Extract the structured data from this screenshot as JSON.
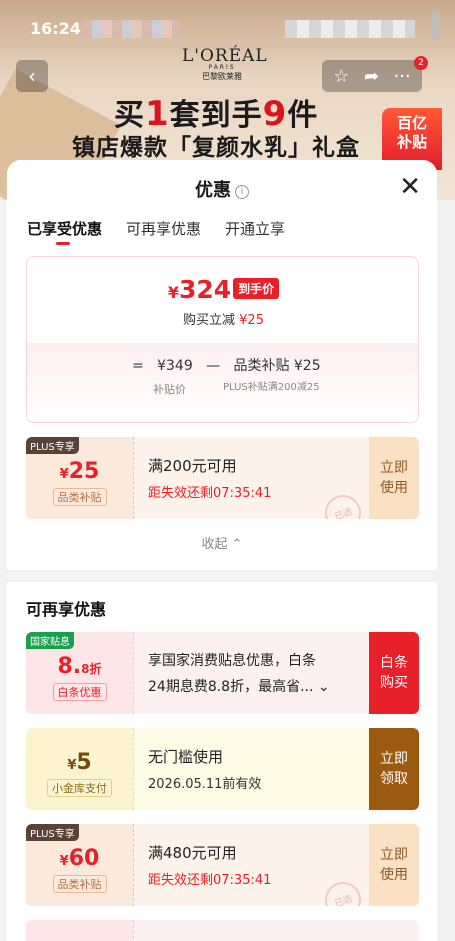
{
  "status_bar": {
    "time": "16:24"
  },
  "banner": {
    "brand_name": "L'ORÉAL",
    "brand_sub": "PARIS",
    "brand_cn": "巴黎欧莱雅",
    "promo_line1_a": "买",
    "promo_line1_num1": "1",
    "promo_line1_b": "套到手",
    "promo_line1_num2": "9",
    "promo_line1_c": "件",
    "promo_line2": "镇店爆款「复颜水乳」礼盒",
    "subsidy_tag_l1": "百亿",
    "subsidy_tag_l2": "补贴",
    "cart_badge": "2"
  },
  "sheet": {
    "title": "优惠",
    "tabs": [
      {
        "label": "已享受优惠",
        "active": true
      },
      {
        "label": "可再享优惠",
        "active": false
      },
      {
        "label": "开通立享",
        "active": false
      }
    ],
    "price_card": {
      "currency": "¥",
      "final_price": "324",
      "final_tag": "到手价",
      "instant_label": "购买立减",
      "instant_amount": "¥25",
      "formula_eq": "=",
      "formula_subsidy_price": "¥349",
      "formula_minus": "—",
      "formula_item": "品类补贴 ¥25",
      "formula_sub1": "补贴价",
      "formula_sub2": "PLUS补贴满200减25"
    },
    "applied_coupons": [
      {
        "corner": "PLUS专享",
        "currency": "¥",
        "value": "25",
        "suffix": "",
        "pill": "品类补贴",
        "line1": "满200元可用",
        "line2": "距失效还剩07:35:41",
        "action": "立即使用",
        "stamp": "已选"
      }
    ],
    "collapse_label": "收起 ⌃"
  },
  "more_offers": {
    "title": "可再享优惠",
    "coupons": [
      {
        "corner": "国家贴息",
        "currency": "",
        "value": "8.",
        "suffix": "8折",
        "pill": "白条优惠",
        "line1": "享国家消费贴息优惠，白条",
        "line2": "24期息费8.8折，最高省... ⌄",
        "action": "白条购买"
      },
      {
        "corner": "",
        "currency": "¥",
        "value": "5",
        "suffix": "",
        "pill": "小金库支付",
        "line1": "无门槛使用",
        "line2": "2026.05.11前有效",
        "action": "立即领取"
      },
      {
        "corner": "PLUS专享",
        "currency": "¥",
        "value": "60",
        "suffix": "",
        "pill": "品类补贴",
        "line1": "满480元可用",
        "line2": "距失效还剩07:35:41",
        "action": "立即使用",
        "stamp": "已选"
      }
    ]
  },
  "colors": {
    "accent_red": "#e8202a",
    "gold": "#9b5a10",
    "plus_dark": "#5b4236",
    "green_tag": "#19a04a"
  }
}
